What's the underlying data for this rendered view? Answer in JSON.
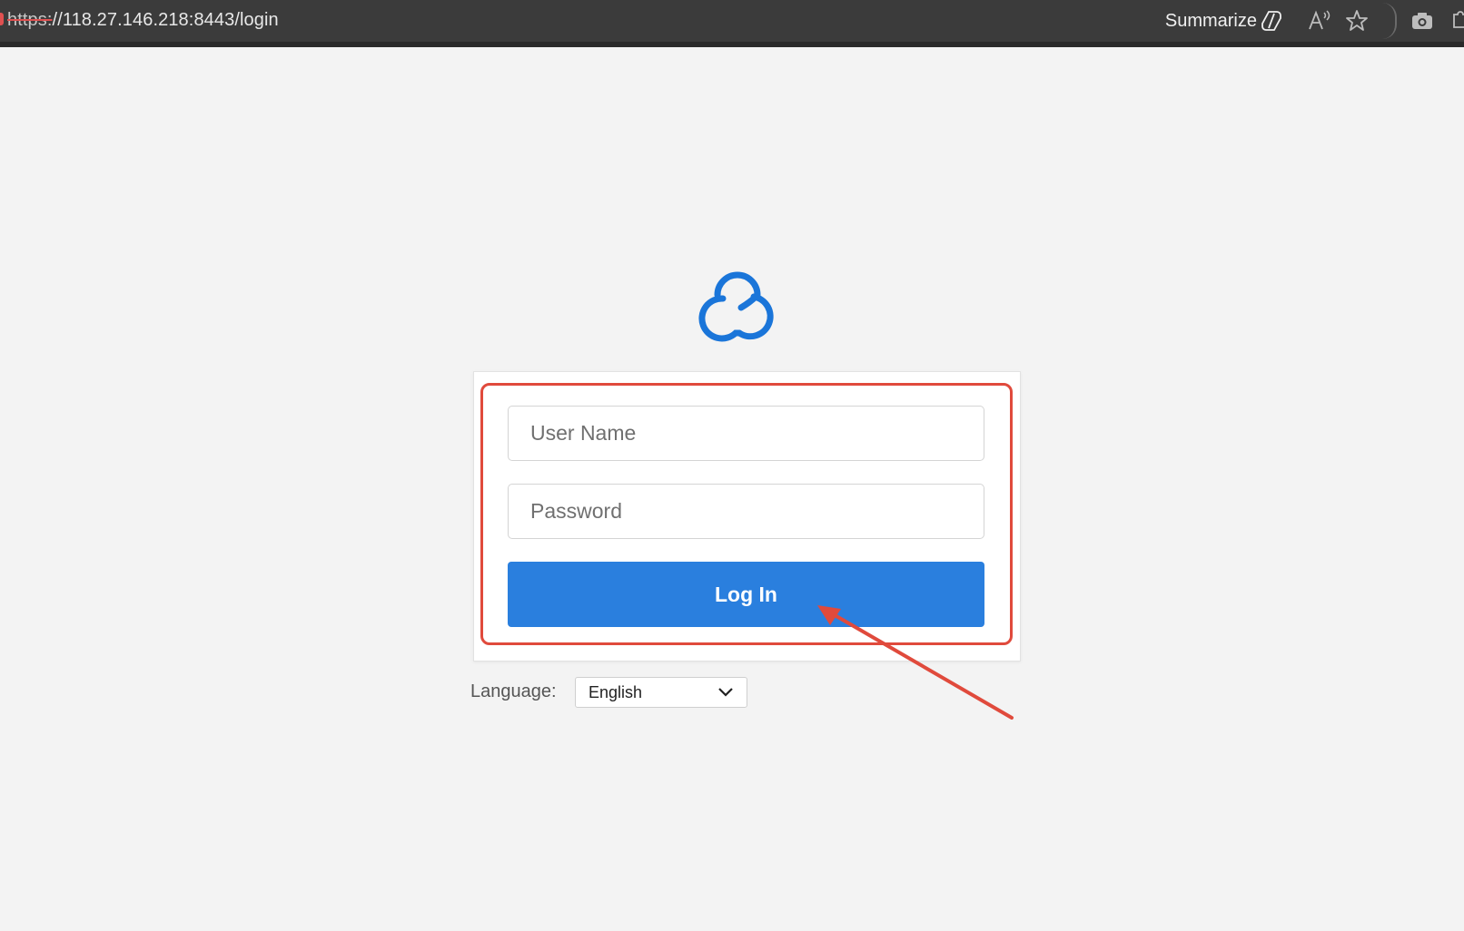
{
  "browser": {
    "url_scheme": "https:",
    "url_rest": "//118.27.146.218:8443/login",
    "summarize_label": "Summarize"
  },
  "login": {
    "username_placeholder": "User Name",
    "password_placeholder": "Password",
    "login_label": "Log In"
  },
  "language": {
    "label": "Language:",
    "selected": "English"
  },
  "colors": {
    "brand": "#1a75d9",
    "button": "#2a7fde",
    "highlight": "#e04a3c"
  },
  "icons": {
    "logo": "cloud-logo-icon",
    "summarize": "copilot-icon",
    "read_aloud": "read-aloud-icon",
    "favorite": "star-icon",
    "screenshot": "camera-icon",
    "extensions": "puzzle-icon",
    "dropdown": "chevron-down-icon"
  }
}
